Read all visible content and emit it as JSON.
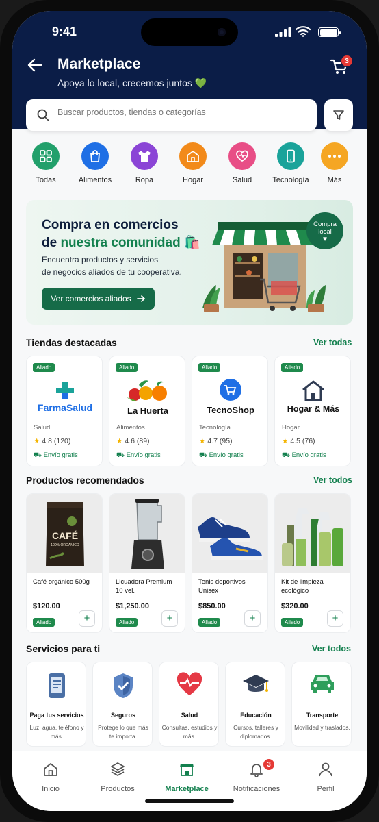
{
  "status": {
    "time": "9:41"
  },
  "header": {
    "title": "Marketplace",
    "subtitle": "Apoya lo local, crecemos juntos 💚",
    "cart_count": "3"
  },
  "search": {
    "placeholder": "Buscar productos, tiendas o categorías"
  },
  "categories": [
    {
      "label": "Todas",
      "icon": "grid-icon",
      "color": "#22a06b"
    },
    {
      "label": "Alimentos",
      "icon": "bag-icon",
      "color": "#1f6fe5"
    },
    {
      "label": "Ropa",
      "icon": "shirt-icon",
      "color": "#8b45d6"
    },
    {
      "label": "Hogar",
      "icon": "home-icon",
      "color": "#f28a1a"
    },
    {
      "label": "Salud",
      "icon": "heart-icon",
      "color": "#e84e86"
    },
    {
      "label": "Tecnología",
      "icon": "phone-icon",
      "color": "#1aa39a"
    },
    {
      "label": "Más",
      "icon": "more-icon",
      "color": "#f5a623"
    }
  ],
  "banner": {
    "title_line1": "Compra en comercios",
    "title_prefix": "de ",
    "title_highlight": "nuestra comunidad",
    "emoji": "🛍️",
    "desc_line1": "Encuentra productos y servicios",
    "desc_line2": "de negocios aliados de tu cooperativa.",
    "button": "Ver comercios aliados",
    "badge_line1": "Compra",
    "badge_line2": "local"
  },
  "stores_section": {
    "title": "Tiendas destacadas",
    "link": "Ver todas"
  },
  "stores": [
    {
      "badge": "Aliado",
      "name": "FarmaSalud",
      "category": "Salud",
      "rating": "4.8",
      "reviews": "(120)",
      "shipping": "Envío gratis"
    },
    {
      "badge": "Aliado",
      "name": "La Huerta",
      "category": "Alimentos",
      "rating": "4.6",
      "reviews": "(89)",
      "shipping": "Envío gratis"
    },
    {
      "badge": "Aliado",
      "name": "TecnoShop",
      "category": "Tecnología",
      "rating": "4.7",
      "reviews": "(95)",
      "shipping": "Envío gratis"
    },
    {
      "badge": "Aliado",
      "name": "Hogar & Más",
      "category": "Hogar",
      "rating": "4.5",
      "reviews": "(76)",
      "shipping": "Envío gratis"
    }
  ],
  "products_section": {
    "title": "Productos recomendados",
    "link": "Ver todos"
  },
  "products": [
    {
      "name": "Café orgánico 500g",
      "price": "$120.00",
      "badge": "Aliado",
      "label_line1": "CAFÉ",
      "label_line2": "100% ORGÁNICO"
    },
    {
      "name": "Licuadora Premium 10 vel.",
      "price": "$1,250.00",
      "badge": "Aliado"
    },
    {
      "name": "Tenis deportivos Unisex",
      "price": "$850.00",
      "badge": "Aliado"
    },
    {
      "name": "Kit de limpieza ecológico",
      "price": "$320.00",
      "badge": "Aliado"
    }
  ],
  "services_section": {
    "title": "Servicios para ti",
    "link": "Ver todos"
  },
  "services": [
    {
      "title": "Paga tus servicios",
      "desc": "Luz, agua, teléfono y más."
    },
    {
      "title": "Seguros",
      "desc": "Protege lo que más te importa."
    },
    {
      "title": "Salud",
      "desc": "Consultas, estudios y más."
    },
    {
      "title": "Educación",
      "desc": "Cursos, talleres y diplomados."
    },
    {
      "title": "Transporte",
      "desc": "Movilidad y traslados."
    }
  ],
  "nav": [
    {
      "label": "Inicio"
    },
    {
      "label": "Productos"
    },
    {
      "label": "Marketplace"
    },
    {
      "label": "Notificaciones",
      "badge": "3"
    },
    {
      "label": "Perfil"
    }
  ],
  "colors": {
    "header": "#0b1d47",
    "accent": "#13804e",
    "badge": "#e53935"
  }
}
